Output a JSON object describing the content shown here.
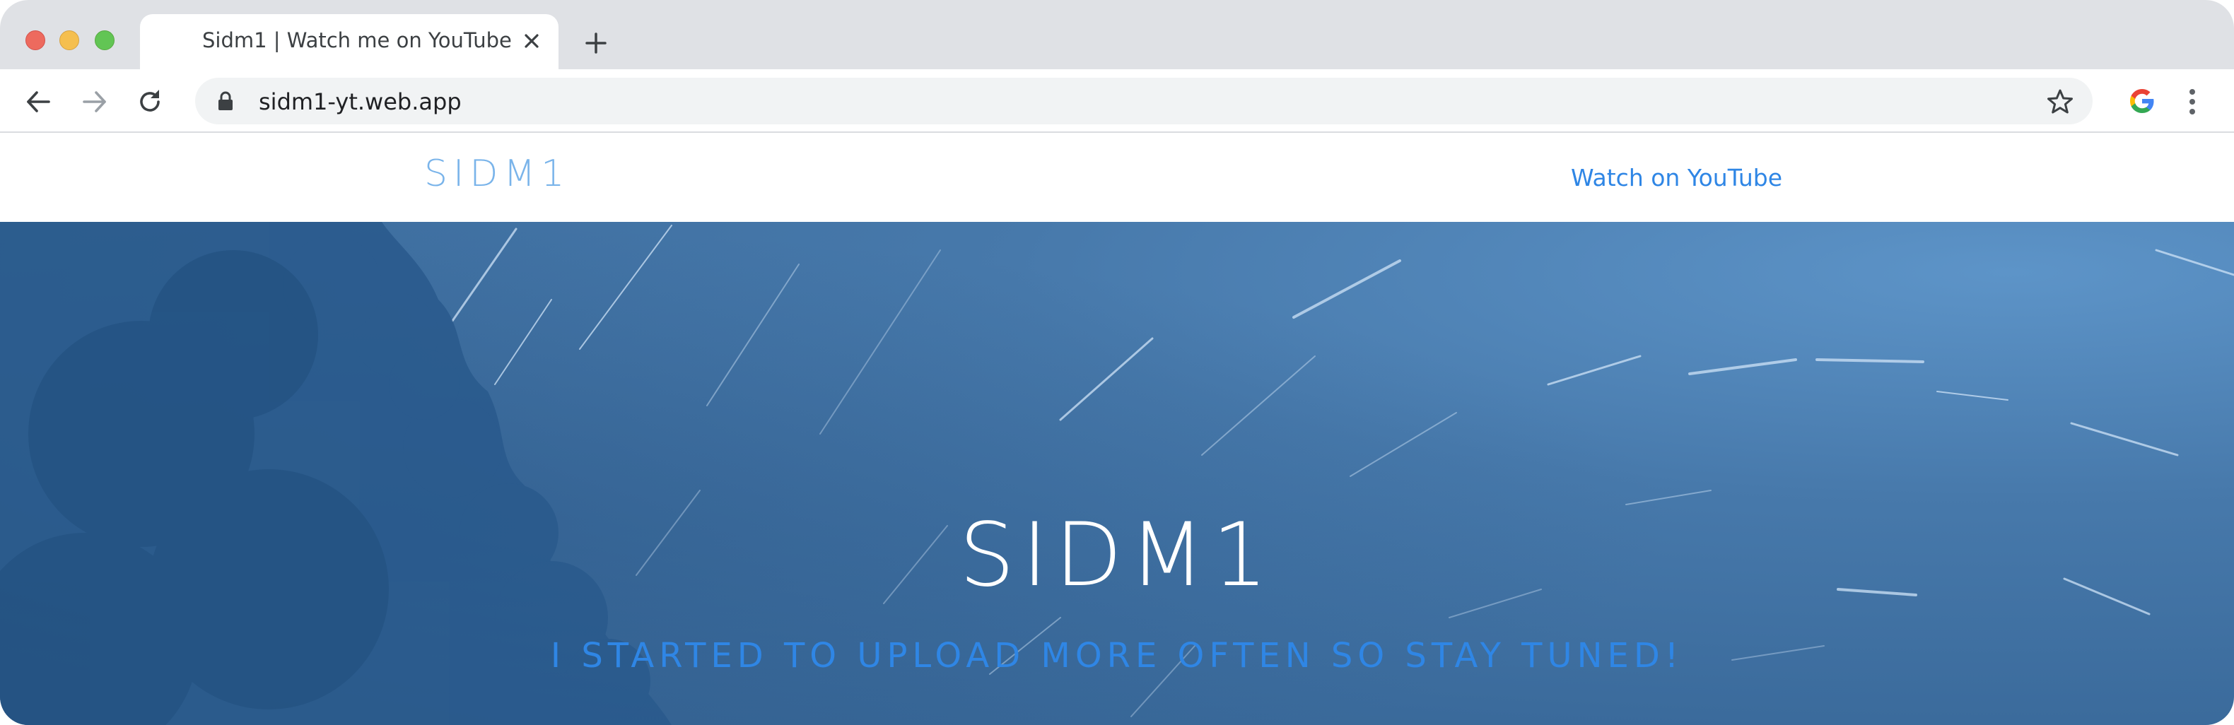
{
  "browser": {
    "tab": {
      "title": "Sidm1 | Watch me on YouTube"
    },
    "address_bar": {
      "url": "sidm1-yt.web.app"
    },
    "icons": {
      "close_tab": "close-icon",
      "new_tab": "plus-icon",
      "back": "arrow-left-icon",
      "forward": "arrow-right-icon",
      "reload": "reload-icon",
      "lock": "lock-icon",
      "bookmark": "star-icon",
      "google": "google-icon",
      "menu": "kebab-menu-icon"
    }
  },
  "site": {
    "brand": "SIDM1",
    "nav_link": "Watch on YouTube"
  },
  "hero": {
    "title": "SIDM1",
    "subtitle": "I STARTED TO UPLOAD MORE OFTEN SO STAY TUNED!"
  },
  "colors": {
    "brand": "#7ab4ea",
    "link": "#2f86e5",
    "hero_background": "#3b6b9c",
    "hero_title": "#ffffff"
  }
}
